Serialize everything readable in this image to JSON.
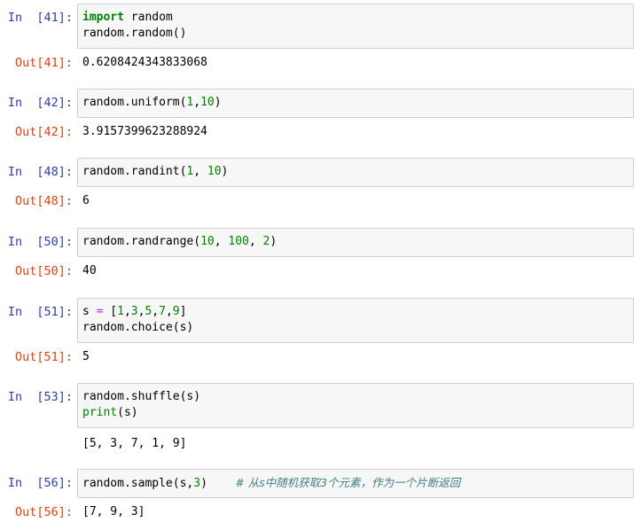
{
  "cells": [
    {
      "in_prompt": "In  [41]:",
      "code": [
        [
          "import",
          " random"
        ],
        [
          "random.random()"
        ]
      ],
      "out_prompt": "Out[41]:",
      "output": "0.6208424343833068"
    },
    {
      "in_prompt": "In  [42]:",
      "code": [
        "random.uniform(1,10)"
      ],
      "out_prompt": "Out[42]:",
      "output": "3.9157399623288924"
    },
    {
      "in_prompt": "In  [48]:",
      "code": [
        "random.randint(1, 10)"
      ],
      "out_prompt": "Out[48]:",
      "output": "6"
    },
    {
      "in_prompt": "In  [50]:",
      "code": [
        "random.randrange(10, 100, 2)"
      ],
      "out_prompt": "Out[50]:",
      "output": "40"
    },
    {
      "in_prompt": "In  [51]:",
      "code": [
        "s = [1,3,5,7,9]",
        "random.choice(s)"
      ],
      "out_prompt": "Out[51]:",
      "output": "5"
    },
    {
      "in_prompt": "In  [53]:",
      "code": [
        "random.shuffle(s)",
        "print(s)"
      ],
      "out_prompt": "",
      "output": "[5, 3, 7, 1, 9]"
    },
    {
      "in_prompt": "In  [56]:",
      "code": [
        "random.sample(s,3)",
        "# 从s中随机获取3个元素，作为一个片断返回"
      ],
      "out_prompt": "Out[56]:",
      "output": "[7, 9, 3]"
    }
  ],
  "tokens": {
    "c0_l0_kw": "import",
    "c0_l0_rest": " random",
    "c0_l1": "random.random()",
    "c1_a": "random.uniform(",
    "c1_n1": "1",
    "c1_b": ",",
    "c1_n2": "10",
    "c1_c": ")",
    "c2_a": "random.randint(",
    "c2_n1": "1",
    "c2_b": ", ",
    "c2_n2": "10",
    "c2_c": ")",
    "c3_a": "random.randrange(",
    "c3_n1": "10",
    "c3_b": ", ",
    "c3_n2": "100",
    "c3_d": ", ",
    "c3_n3": "2",
    "c3_c": ")",
    "c4_a": "s ",
    "c4_op": "=",
    "c4_b": " [",
    "c4_n1": "1",
    "c4_n2": "3",
    "c4_n3": "5",
    "c4_n4": "7",
    "c4_n5": "9",
    "c4_comma": ",",
    "c4_c": "]",
    "c4_l1": "random.choice(s)",
    "c5_l0": "random.shuffle(s)",
    "c5_kw": "print",
    "c5_rest": "(s)",
    "c6_a": "random.sample(s,",
    "c6_n": "3",
    "c6_c": ")",
    "c6_comment": "# 从s中随机获取3个元素，作为一个片断返回"
  }
}
